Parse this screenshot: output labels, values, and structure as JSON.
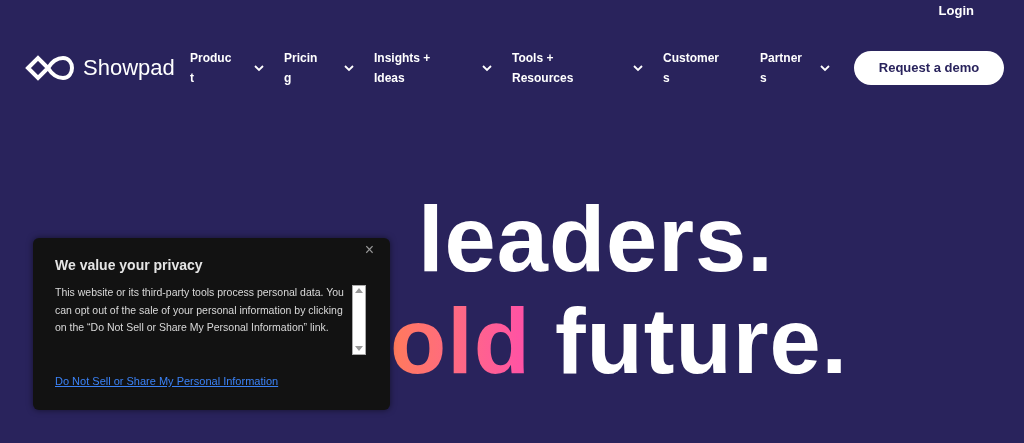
{
  "header": {
    "login": "Login",
    "logo": {
      "text": "Showpad"
    },
    "nav": [
      {
        "label": "Product",
        "has_menu": true
      },
      {
        "label": "Pricing",
        "has_menu": true
      },
      {
        "label": "Insights + Ideas",
        "has_menu": true
      },
      {
        "label": "Tools + Resources",
        "has_menu": true
      },
      {
        "label": "Customers",
        "has_menu": false
      },
      {
        "label": "Partners",
        "has_menu": true
      }
    ],
    "cta": "Request a demo"
  },
  "hero": {
    "line_1": [
      {
        "text": "leaders.",
        "kind": "plain"
      }
    ],
    "line_2": [
      {
        "text": "old",
        "kind": "accent"
      },
      {
        "text": "future.",
        "kind": "plain"
      }
    ]
  },
  "privacy_dialog": {
    "title": "We value your privacy",
    "close": "×",
    "body": "This website or its third-party tools process personal data. You can opt out of the sale of your personal information by clicking on the “Do Not Sell or Share My Personal Information” link.",
    "link": "Do Not Sell or Share My Personal Information"
  }
}
